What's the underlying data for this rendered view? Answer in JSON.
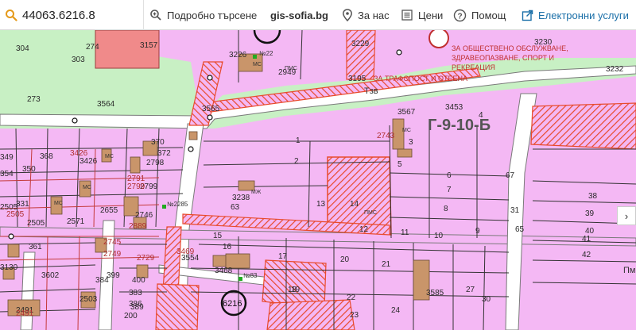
{
  "search": {
    "value": "44063.6216.8"
  },
  "nav": {
    "detailed_search": "Подробно търсене",
    "brand": "gis-sofia.bg",
    "about": "За нас",
    "prices": "Цени",
    "help": "Помощ",
    "eservices": "Електронни услуги"
  },
  "map": {
    "zone_label": "Г-9-10-Б",
    "public_label_1": "ЗА ОБЩЕСТВЕНО ОБСЛУЖВАНЕ,",
    "public_label_2": "ЗДРАВЕОПАЗВАНЕ, СПОРТ И",
    "public_label_3": "РЕКРЕАЦИЯ",
    "substation_label": "ЗА ТРАФОПОСТ И ОТЕЕНА",
    "tzv_label": "Тзв",
    "pm_label": "Пм",
    "circle_label": "6216",
    "parcel_numbers_dark": [
      "304",
      "303",
      "274",
      "273",
      "3564",
      "3157",
      "3226",
      "2949",
      "3229",
      "3195",
      "3230",
      "3232",
      "3565",
      "3567",
      "3453",
      "349",
      "368",
      "354",
      "350",
      "331",
      "3505",
      "2571",
      "2655",
      "2746",
      "2799",
      "2798",
      "3426",
      "370",
      "372",
      "3238",
      "63",
      "1",
      "2",
      "13",
      "5",
      "6",
      "7",
      "8",
      "3",
      "4",
      "67",
      "38",
      "39",
      "40",
      "41",
      "42",
      "9",
      "10",
      "11",
      "12",
      "14",
      "15",
      "16",
      "17",
      "18",
      "19",
      "20",
      "21",
      "22",
      "23",
      "24",
      "27",
      "30",
      "31",
      "65",
      "3554",
      "3468",
      "3585",
      "361",
      "3602",
      "384",
      "399",
      "389",
      "3130",
      "2503",
      "2491",
      "2505",
      "200",
      "383",
      "400",
      "386"
    ],
    "parcel_numbers_red": [
      "3426",
      "2743",
      "2791",
      "2799",
      "2889",
      "2745",
      "2729",
      "2749",
      "2505",
      "2491",
      "3469"
    ],
    "building_labels": [
      "МС",
      "МС",
      "МЖ",
      "МС",
      "МС",
      "МС",
      "ПМС",
      "ПМС"
    ],
    "plot_labels": [
      "№2285",
      "№22",
      "№83"
    ]
  },
  "icons": {
    "search": "magnifier-icon",
    "detailed_search": "zoom-in-icon",
    "about": "map-pin-icon",
    "prices": "price-list-icon",
    "help": "help-circle-icon",
    "eservices": "external-link-icon",
    "zoom": "scroll-right-icon"
  },
  "colors": {
    "residential": "#f4b8f4",
    "green": "#c8f0c4",
    "road": "#ffffff",
    "hatch": "#e84a2c",
    "building": "#c9956a",
    "brand_blue": "#1a6fa8"
  }
}
